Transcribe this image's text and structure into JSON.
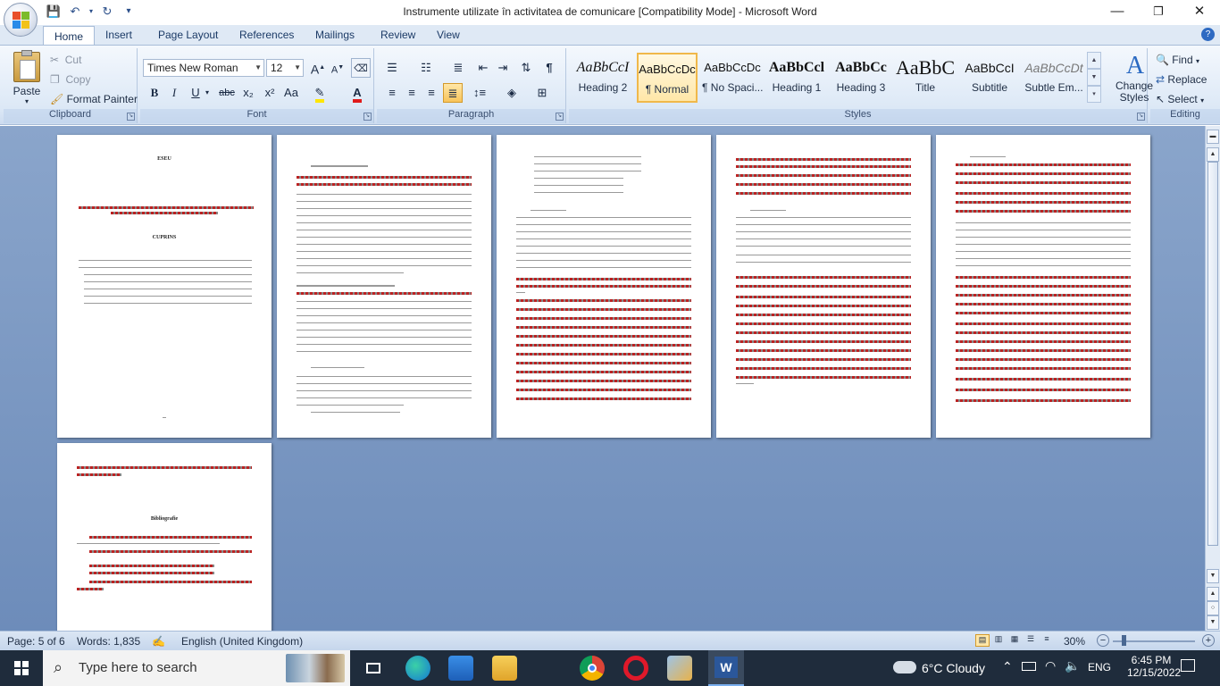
{
  "window": {
    "title": "Instrumente utilizate în activitatea de comunicare [Compatibility Mode] - Microsoft Word",
    "minimize": "—",
    "restore": "❐",
    "close": "✕"
  },
  "qat": {
    "save": "save-icon",
    "undo": "undo-icon",
    "redo": "redo-icon",
    "customize": "customize-icon"
  },
  "tabs": [
    {
      "label": "Home"
    },
    {
      "label": "Insert"
    },
    {
      "label": "Page Layout"
    },
    {
      "label": "References"
    },
    {
      "label": "Mailings"
    },
    {
      "label": "Review"
    },
    {
      "label": "View"
    }
  ],
  "clipboard": {
    "paste": "Paste",
    "cut": "Cut",
    "copy": "Copy",
    "format_painter": "Format Painter",
    "label": "Clipboard"
  },
  "font": {
    "name": "Times New Roman",
    "size": "12",
    "label": "Font",
    "bold": "B",
    "italic": "I",
    "underline": "U",
    "strike": "abc",
    "sub": "x₂",
    "sup": "x²",
    "case": "Aa",
    "grow": "A",
    "shrink": "A"
  },
  "paragraph": {
    "label": "Paragraph"
  },
  "styles": {
    "label": "Styles",
    "items": [
      {
        "sample": "AaBbCcI",
        "name": "Heading 2"
      },
      {
        "sample": "AaBbCcDc",
        "name": "¶ Normal"
      },
      {
        "sample": "AaBbCcDc",
        "name": "¶ No Spaci..."
      },
      {
        "sample": "AaBbCcl",
        "name": "Heading 1"
      },
      {
        "sample": "AaBbCc",
        "name": "Heading 3"
      },
      {
        "sample": "AaBbC",
        "name": "Title"
      },
      {
        "sample": "AaBbCcI",
        "name": "Subtitle"
      },
      {
        "sample": "AaBbCcDt",
        "name": "Subtle Em..."
      }
    ],
    "change_styles": "Change Styles"
  },
  "editing": {
    "find": "Find",
    "replace": "Replace",
    "select": "Select",
    "label": "Editing"
  },
  "pages": {
    "p1_title": "ESEU",
    "p1_subtitle": "CUPRINS",
    "p6_title": "Bibliografie"
  },
  "status": {
    "page": "Page: 5 of 6",
    "words": "Words: 1,835",
    "language": "English (United Kingdom)",
    "zoom": "30%"
  },
  "taskbar": {
    "search_placeholder": "Type here to search",
    "weather": "6°C  Cloudy",
    "lang": "ENG",
    "time": "6:45 PM",
    "date": "12/15/2022"
  },
  "colors": {
    "ribbon_bg": "#dce8f6",
    "doc_bg": "#7a98c4",
    "taskbar": "#1f2c3c",
    "accent": "#2b579a"
  }
}
